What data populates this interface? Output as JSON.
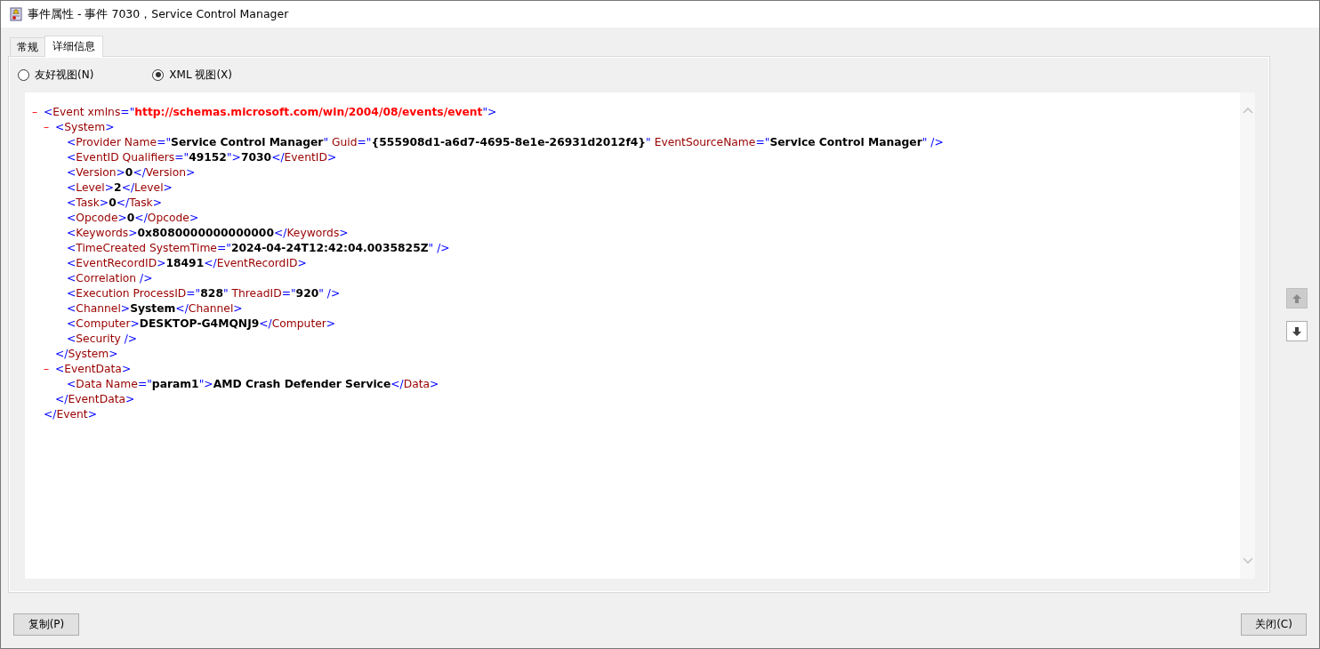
{
  "window": {
    "title": "事件属性 - 事件 7030，Service Control Manager"
  },
  "tabs": [
    {
      "label": "常规",
      "selected": false
    },
    {
      "label": "详细信息",
      "selected": true
    }
  ],
  "view_options": [
    {
      "label": "友好视图(N)",
      "selected": false
    },
    {
      "label": "XML 视图(X)",
      "selected": true
    }
  ],
  "xml": {
    "toggle": "–",
    "expanded": true,
    "line": [
      {
        "kind": "punct",
        "text": "<"
      },
      {
        "kind": "name",
        "text": "Event xmlns"
      },
      {
        "kind": "punct",
        "text": "=\""
      },
      {
        "kind": "ns",
        "text": "http://schemas.microsoft.com/win/2004/08/events/event"
      },
      {
        "kind": "punct",
        "text": "\">"
      }
    ],
    "children": [
      {
        "toggle": "–",
        "expanded": true,
        "line": [
          {
            "kind": "punct",
            "text": "<"
          },
          {
            "kind": "name",
            "text": "System"
          },
          {
            "kind": "punct",
            "text": ">"
          }
        ],
        "children": [
          {
            "line": [
              {
                "kind": "punct",
                "text": "<"
              },
              {
                "kind": "name",
                "text": "Provider Name"
              },
              {
                "kind": "punct",
                "text": "=\""
              },
              {
                "kind": "value",
                "text": "Service Control Manager"
              },
              {
                "kind": "punct",
                "text": "\" "
              },
              {
                "kind": "name",
                "text": "Guid"
              },
              {
                "kind": "punct",
                "text": "=\""
              },
              {
                "kind": "value",
                "text": "{555908d1-a6d7-4695-8e1e-26931d2012f4}"
              },
              {
                "kind": "punct",
                "text": "\" "
              },
              {
                "kind": "name",
                "text": "EventSourceName"
              },
              {
                "kind": "punct",
                "text": "=\""
              },
              {
                "kind": "value",
                "text": "Service Control Manager"
              },
              {
                "kind": "punct",
                "text": "\" />"
              }
            ]
          },
          {
            "line": [
              {
                "kind": "punct",
                "text": "<"
              },
              {
                "kind": "name",
                "text": "EventID Qualifiers"
              },
              {
                "kind": "punct",
                "text": "=\""
              },
              {
                "kind": "value",
                "text": "49152"
              },
              {
                "kind": "punct",
                "text": "\">"
              },
              {
                "kind": "value",
                "text": "7030"
              },
              {
                "kind": "punct",
                "text": "</"
              },
              {
                "kind": "name",
                "text": "EventID"
              },
              {
                "kind": "punct",
                "text": ">"
              }
            ]
          },
          {
            "line": [
              {
                "kind": "punct",
                "text": "<"
              },
              {
                "kind": "name",
                "text": "Version"
              },
              {
                "kind": "punct",
                "text": ">"
              },
              {
                "kind": "value",
                "text": "0"
              },
              {
                "kind": "punct",
                "text": "</"
              },
              {
                "kind": "name",
                "text": "Version"
              },
              {
                "kind": "punct",
                "text": ">"
              }
            ]
          },
          {
            "line": [
              {
                "kind": "punct",
                "text": "<"
              },
              {
                "kind": "name",
                "text": "Level"
              },
              {
                "kind": "punct",
                "text": ">"
              },
              {
                "kind": "value",
                "text": "2"
              },
              {
                "kind": "punct",
                "text": "</"
              },
              {
                "kind": "name",
                "text": "Level"
              },
              {
                "kind": "punct",
                "text": ">"
              }
            ]
          },
          {
            "line": [
              {
                "kind": "punct",
                "text": "<"
              },
              {
                "kind": "name",
                "text": "Task"
              },
              {
                "kind": "punct",
                "text": ">"
              },
              {
                "kind": "value",
                "text": "0"
              },
              {
                "kind": "punct",
                "text": "</"
              },
              {
                "kind": "name",
                "text": "Task"
              },
              {
                "kind": "punct",
                "text": ">"
              }
            ]
          },
          {
            "line": [
              {
                "kind": "punct",
                "text": "<"
              },
              {
                "kind": "name",
                "text": "Opcode"
              },
              {
                "kind": "punct",
                "text": ">"
              },
              {
                "kind": "value",
                "text": "0"
              },
              {
                "kind": "punct",
                "text": "</"
              },
              {
                "kind": "name",
                "text": "Opcode"
              },
              {
                "kind": "punct",
                "text": ">"
              }
            ]
          },
          {
            "line": [
              {
                "kind": "punct",
                "text": "<"
              },
              {
                "kind": "name",
                "text": "Keywords"
              },
              {
                "kind": "punct",
                "text": ">"
              },
              {
                "kind": "value",
                "text": "0x8080000000000000"
              },
              {
                "kind": "punct",
                "text": "</"
              },
              {
                "kind": "name",
                "text": "Keywords"
              },
              {
                "kind": "punct",
                "text": ">"
              }
            ]
          },
          {
            "line": [
              {
                "kind": "punct",
                "text": "<"
              },
              {
                "kind": "name",
                "text": "TimeCreated SystemTime"
              },
              {
                "kind": "punct",
                "text": "=\""
              },
              {
                "kind": "value",
                "text": "2024-04-24T12:42:04.0035825Z"
              },
              {
                "kind": "punct",
                "text": "\" />"
              }
            ]
          },
          {
            "line": [
              {
                "kind": "punct",
                "text": "<"
              },
              {
                "kind": "name",
                "text": "EventRecordID"
              },
              {
                "kind": "punct",
                "text": ">"
              },
              {
                "kind": "value",
                "text": "18491"
              },
              {
                "kind": "punct",
                "text": "</"
              },
              {
                "kind": "name",
                "text": "EventRecordID"
              },
              {
                "kind": "punct",
                "text": ">"
              }
            ]
          },
          {
            "line": [
              {
                "kind": "punct",
                "text": "<"
              },
              {
                "kind": "name",
                "text": "Correlation"
              },
              {
                "kind": "punct",
                "text": " />"
              }
            ]
          },
          {
            "line": [
              {
                "kind": "punct",
                "text": "<"
              },
              {
                "kind": "name",
                "text": "Execution ProcessID"
              },
              {
                "kind": "punct",
                "text": "=\""
              },
              {
                "kind": "value",
                "text": "828"
              },
              {
                "kind": "punct",
                "text": "\" "
              },
              {
                "kind": "name",
                "text": "ThreadID"
              },
              {
                "kind": "punct",
                "text": "=\""
              },
              {
                "kind": "value",
                "text": "920"
              },
              {
                "kind": "punct",
                "text": "\" />"
              }
            ]
          },
          {
            "line": [
              {
                "kind": "punct",
                "text": "<"
              },
              {
                "kind": "name",
                "text": "Channel"
              },
              {
                "kind": "punct",
                "text": ">"
              },
              {
                "kind": "value",
                "text": "System"
              },
              {
                "kind": "punct",
                "text": "</"
              },
              {
                "kind": "name",
                "text": "Channel"
              },
              {
                "kind": "punct",
                "text": ">"
              }
            ]
          },
          {
            "line": [
              {
                "kind": "punct",
                "text": "<"
              },
              {
                "kind": "name",
                "text": "Computer"
              },
              {
                "kind": "punct",
                "text": ">"
              },
              {
                "kind": "value",
                "text": "DESKTOP-G4MQNJ9"
              },
              {
                "kind": "punct",
                "text": "</"
              },
              {
                "kind": "name",
                "text": "Computer"
              },
              {
                "kind": "punct",
                "text": ">"
              }
            ]
          },
          {
            "line": [
              {
                "kind": "punct",
                "text": "<"
              },
              {
                "kind": "name",
                "text": "Security"
              },
              {
                "kind": "punct",
                "text": " />"
              }
            ]
          }
        ],
        "closing": [
          {
            "kind": "punct",
            "text": "</"
          },
          {
            "kind": "name",
            "text": "System"
          },
          {
            "kind": "punct",
            "text": ">"
          }
        ]
      },
      {
        "toggle": "–",
        "expanded": true,
        "line": [
          {
            "kind": "punct",
            "text": "<"
          },
          {
            "kind": "name",
            "text": "EventData"
          },
          {
            "kind": "punct",
            "text": ">"
          }
        ],
        "children": [
          {
            "line": [
              {
                "kind": "punct",
                "text": "<"
              },
              {
                "kind": "name",
                "text": "Data Name"
              },
              {
                "kind": "punct",
                "text": "=\""
              },
              {
                "kind": "value",
                "text": "param1"
              },
              {
                "kind": "punct",
                "text": "\">"
              },
              {
                "kind": "value",
                "text": "AMD Crash Defender Service"
              },
              {
                "kind": "punct",
                "text": "</"
              },
              {
                "kind": "name",
                "text": "Data"
              },
              {
                "kind": "punct",
                "text": ">"
              }
            ]
          }
        ],
        "closing": [
          {
            "kind": "punct",
            "text": "</"
          },
          {
            "kind": "name",
            "text": "EventData"
          },
          {
            "kind": "punct",
            "text": ">"
          }
        ]
      }
    ],
    "closing": [
      {
        "kind": "punct",
        "text": "</"
      },
      {
        "kind": "name",
        "text": "Event"
      },
      {
        "kind": "punct",
        "text": ">"
      }
    ]
  },
  "nav_buttons": [
    {
      "kind": "up",
      "disabled": true
    },
    {
      "kind": "down",
      "disabled": false
    }
  ],
  "buttons": [
    {
      "label": "复制(P)"
    },
    {
      "label": "关闭(C)"
    }
  ]
}
